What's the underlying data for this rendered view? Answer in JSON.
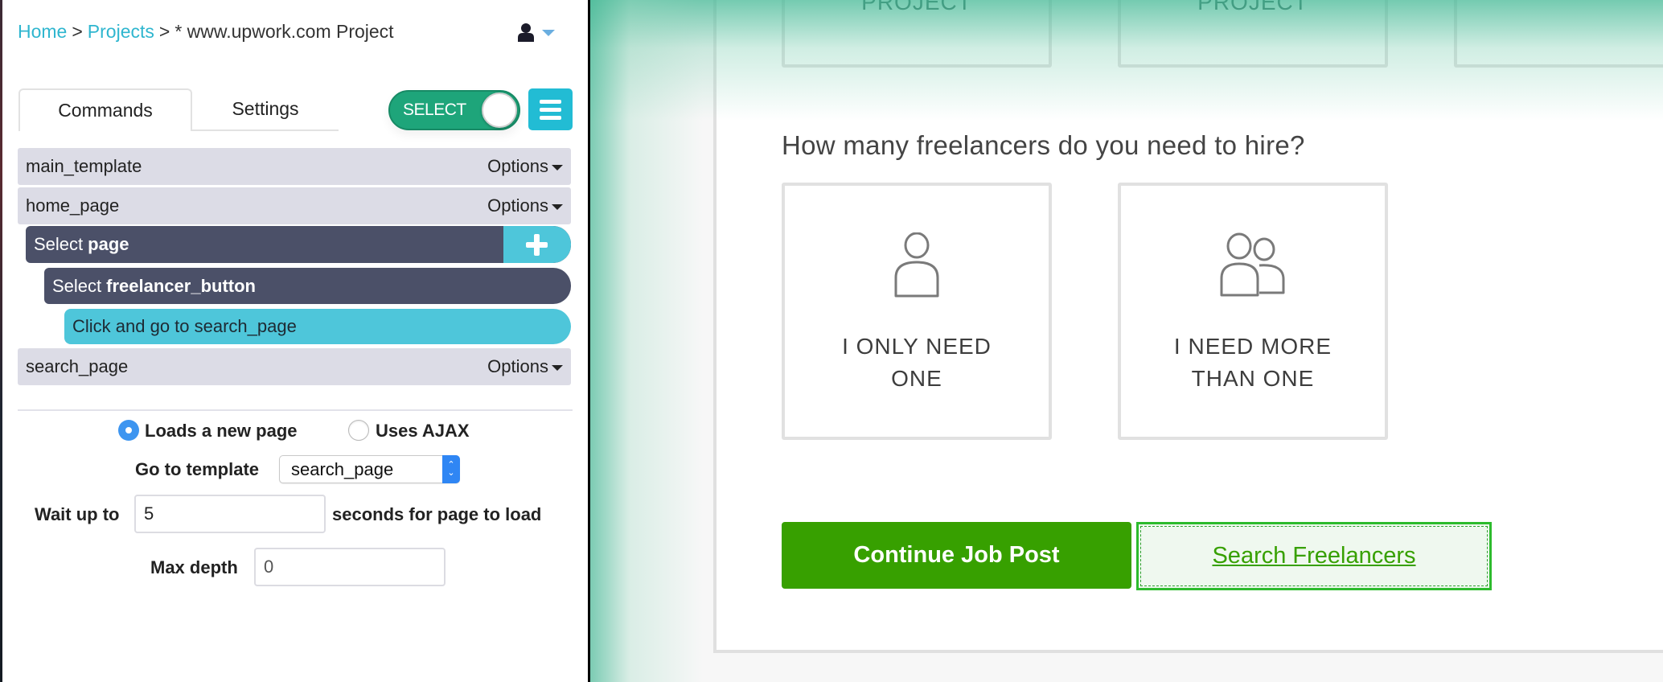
{
  "breadcrumb": {
    "home": "Home",
    "projects": "Projects",
    "separator": ">",
    "current": "* www.upwork.com Project"
  },
  "user_menu": {
    "icon": "user-icon",
    "caret": "caret-down-icon"
  },
  "tabs": [
    {
      "label": "Commands",
      "active": true
    },
    {
      "label": "Settings",
      "active": false
    }
  ],
  "select_toggle": {
    "label": "SELECT",
    "on": true
  },
  "menu_button": {
    "icon": "hamburger-menu-icon"
  },
  "command_tree": {
    "templates": [
      {
        "name": "main_template",
        "options_label": "Options"
      },
      {
        "name": "home_page",
        "options_label": "Options"
      },
      {
        "name": "search_page",
        "options_label": "Options"
      }
    ],
    "commands": [
      {
        "verb": "Select",
        "target": "page",
        "level": 1
      },
      {
        "verb": "Select",
        "target": "freelancer_button",
        "level": 2
      },
      {
        "text": "Click and go to search_page",
        "level": 3
      }
    ],
    "add_icon": "plus-icon"
  },
  "click_options": {
    "radios": [
      {
        "label": "Loads a new page",
        "checked": true
      },
      {
        "label": "Uses AJAX",
        "checked": false
      }
    ],
    "go_to_template_label": "Go to template",
    "go_to_template_value": "search_page",
    "wait_label": "Wait up to",
    "wait_value": "5",
    "wait_suffix": "seconds for page to load",
    "max_depth_label": "Max depth",
    "max_depth_value": "0"
  },
  "web_page": {
    "top_cards": [
      {
        "label": "PROJECT"
      },
      {
        "label": "PROJECT"
      },
      {
        "label": ""
      }
    ],
    "question": "How many freelancers do you need to hire?",
    "choices": [
      {
        "line1": "I ONLY NEED",
        "line2": "ONE",
        "icon": "single-person-icon"
      },
      {
        "line1": "I NEED MORE",
        "line2": "THAN ONE",
        "icon": "two-people-icon"
      }
    ],
    "continue_button": "Continue Job Post",
    "search_button": "Search Freelancers",
    "colors": {
      "primary_green": "#37a000",
      "highlight_green": "#2dbb2d",
      "select_toggle": "#1ea57a",
      "accent_cyan": "#22bcd4"
    }
  }
}
